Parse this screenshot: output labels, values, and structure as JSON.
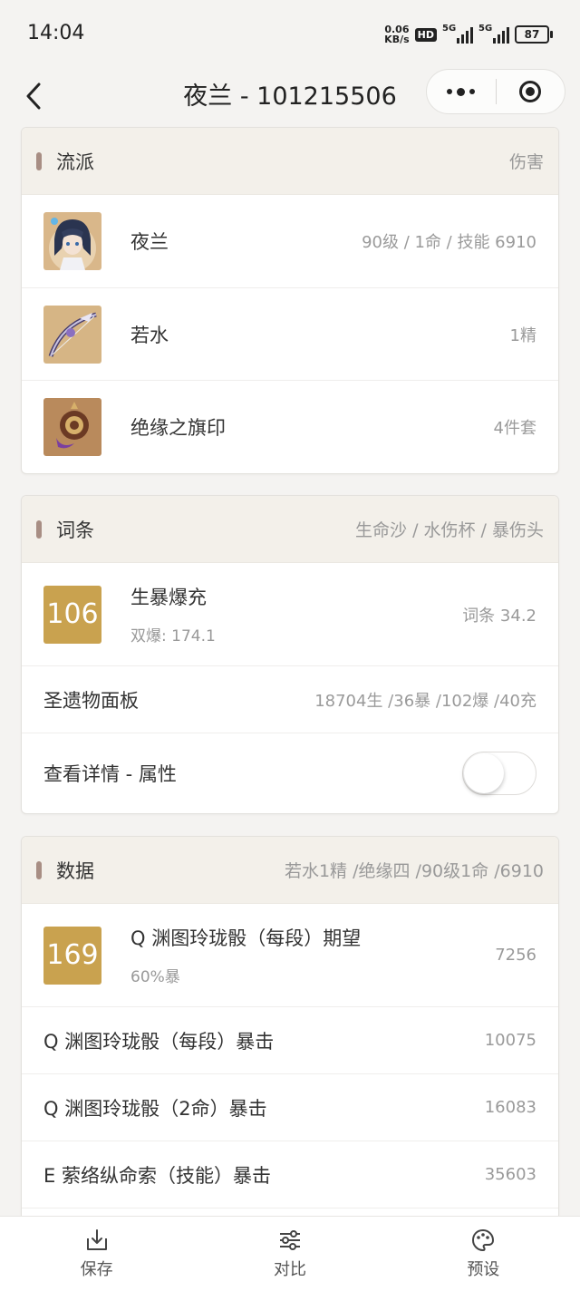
{
  "status": {
    "time": "14:04",
    "speed_value": "0.06",
    "speed_unit": "KB/s",
    "hd": "HD",
    "net1": "5G",
    "net2": "5G",
    "battery": "87"
  },
  "nav": {
    "title": "夜兰 - 101215506"
  },
  "build": {
    "header": "流派",
    "header_right": "伤害",
    "rows": [
      {
        "name": "夜兰",
        "value": "90级 / 1命 / 技能 6910",
        "icon": "character-portrait"
      },
      {
        "name": "若水",
        "value": "1精",
        "icon": "bow-weapon"
      },
      {
        "name": "绝缘之旗印",
        "value": "4件套",
        "icon": "artifact-set"
      }
    ]
  },
  "substats": {
    "header": "词条",
    "header_right": "生命沙 / 水伤杯 / 暴伤头",
    "score": "106",
    "title": "生暴爆充",
    "sub": "双爆: 174.1",
    "value": "词条 34.2",
    "panel_label": "圣遗物面板",
    "panel_value": "18704生 /36暴 /102爆 /40充",
    "detail_label": "查看详情 - 属性",
    "detail_toggle": false
  },
  "damage": {
    "header": "数据",
    "header_right": "若水1精 /绝缘四 /90级1命 /6910",
    "score": "169",
    "title": "Q 渊图玲珑骰（每段）期望",
    "sub": "60%暴",
    "value": "7256",
    "rows": [
      {
        "label": "Q 渊图玲珑骰（每段）暴击",
        "value": "10075"
      },
      {
        "label": "Q 渊图玲珑骰（2命）暴击",
        "value": "16083"
      },
      {
        "label": "E 萦络纵命索（技能）暴击",
        "value": "35603"
      }
    ]
  },
  "tabs": [
    {
      "label": "保存",
      "icon": "download-icon"
    },
    {
      "label": "对比",
      "icon": "sliders-icon"
    },
    {
      "label": "预设",
      "icon": "palette-icon"
    }
  ]
}
